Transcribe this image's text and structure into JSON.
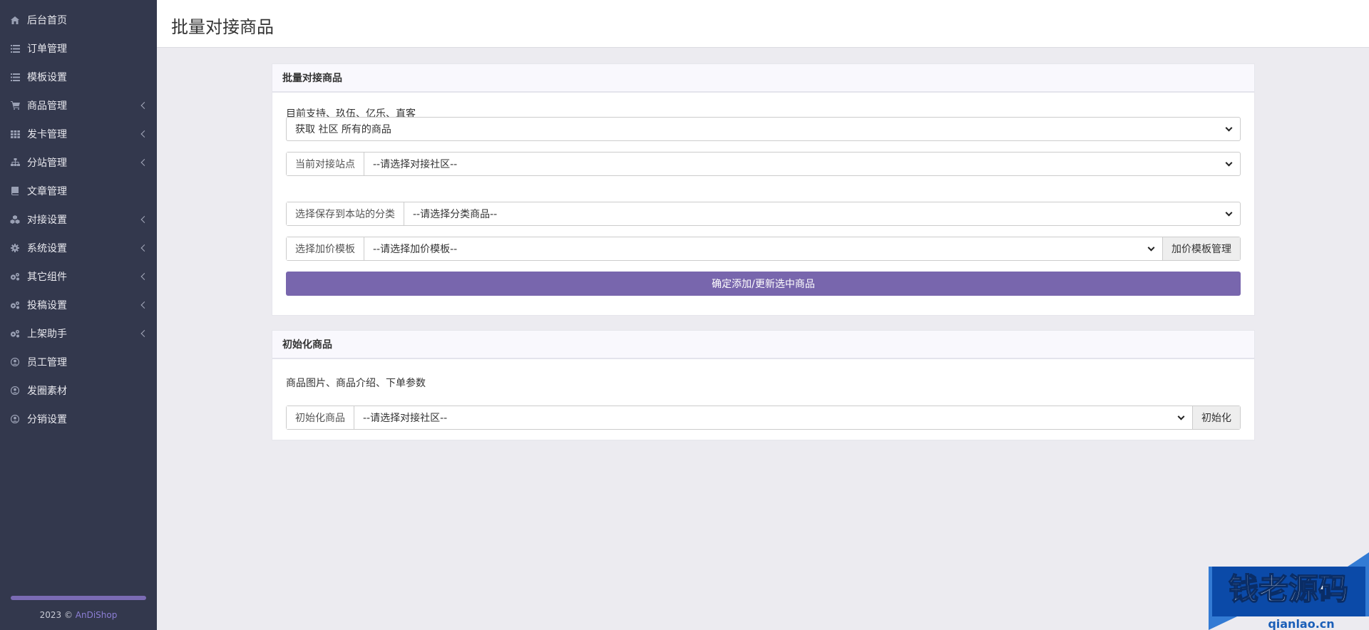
{
  "sidebar": {
    "items": [
      {
        "label": "后台首页",
        "icon": "home-icon",
        "has_submenu": false
      },
      {
        "label": "订单管理",
        "icon": "list-icon",
        "has_submenu": false
      },
      {
        "label": "模板设置",
        "icon": "list-icon",
        "has_submenu": false
      },
      {
        "label": "商品管理",
        "icon": "cart-icon",
        "has_submenu": true
      },
      {
        "label": "发卡管理",
        "icon": "grid-icon",
        "has_submenu": true
      },
      {
        "label": "分站管理",
        "icon": "sitemap-icon",
        "has_submenu": true
      },
      {
        "label": "文章管理",
        "icon": "book-icon",
        "has_submenu": false
      },
      {
        "label": "对接设置",
        "icon": "cubes-icon",
        "has_submenu": true
      },
      {
        "label": "系统设置",
        "icon": "gear-icon",
        "has_submenu": true
      },
      {
        "label": "其它组件",
        "icon": "gears-icon",
        "has_submenu": true
      },
      {
        "label": "投稿设置",
        "icon": "gears-icon",
        "has_submenu": true
      },
      {
        "label": "上架助手",
        "icon": "gears-icon",
        "has_submenu": true
      },
      {
        "label": "员工管理",
        "icon": "user-circle-icon",
        "has_submenu": false
      },
      {
        "label": "发圈素材",
        "icon": "user-circle-icon",
        "has_submenu": false
      },
      {
        "label": "分销设置",
        "icon": "user-circle-icon",
        "has_submenu": false
      }
    ],
    "footer": {
      "year": "2023 ©",
      "brand": "AnDiShop"
    }
  },
  "header": {
    "title": "批量对接商品"
  },
  "batch_panel": {
    "title": "批量对接商品",
    "support_text": "目前支持、玖伍、亿乐、直客",
    "fetch_select": "获取 社区 所有的商品",
    "site_label": "当前对接站点",
    "site_value": "--请选择对接社区--",
    "category_label": "选择保存到本站的分类",
    "category_value": "--请选择分类商品--",
    "markup_label": "选择加价模板",
    "markup_value": "--请选择加价模板--",
    "markup_manage_button": "加价模板管理",
    "submit_button": "确定添加/更新选中商品"
  },
  "init_panel": {
    "title": "初始化商品",
    "desc_text": "商品图片、商品介绍、下单参数",
    "init_label": "初始化商品",
    "init_value": "--请选择对接社区--",
    "init_button": "初始化"
  },
  "watermark": {
    "text": "钱老源码",
    "domain": "qianlao.cn"
  },
  "colors": {
    "sidebar_bg": "#33384d",
    "primary": "#7866ad",
    "page_bg": "#ecebf0"
  }
}
